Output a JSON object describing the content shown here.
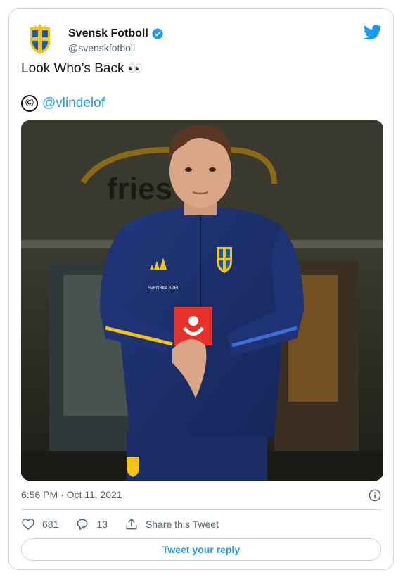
{
  "author": {
    "display_name": "Svensk Fotboll",
    "handle": "@svenskfotboll",
    "avatar_icon": "swedish-crest-icon",
    "verified_icon": "verified-badge-icon"
  },
  "brand_icon": "twitter-bird-icon",
  "tweet": {
    "text": "Look Who’s Back",
    "emoji": "👀",
    "credit_symbol": "©",
    "credit_mention": "@vlindelof"
  },
  "photo": {
    "background_sign": "fries",
    "jersey_sponsor": "SVENSKA SPEL"
  },
  "meta": {
    "timestamp": "6:56 PM · Oct 11, 2021"
  },
  "actions": {
    "likes": "681",
    "replies": "13",
    "share_label": "Share this Tweet"
  },
  "reply_button_label": "Tweet your reply",
  "colors": {
    "accent": "#1d9bf0",
    "text": "#0f1419",
    "muted": "#536471",
    "border": "#cfd9de",
    "kit_blue": "#1c2f6b",
    "kit_yellow": "#f3c416"
  }
}
